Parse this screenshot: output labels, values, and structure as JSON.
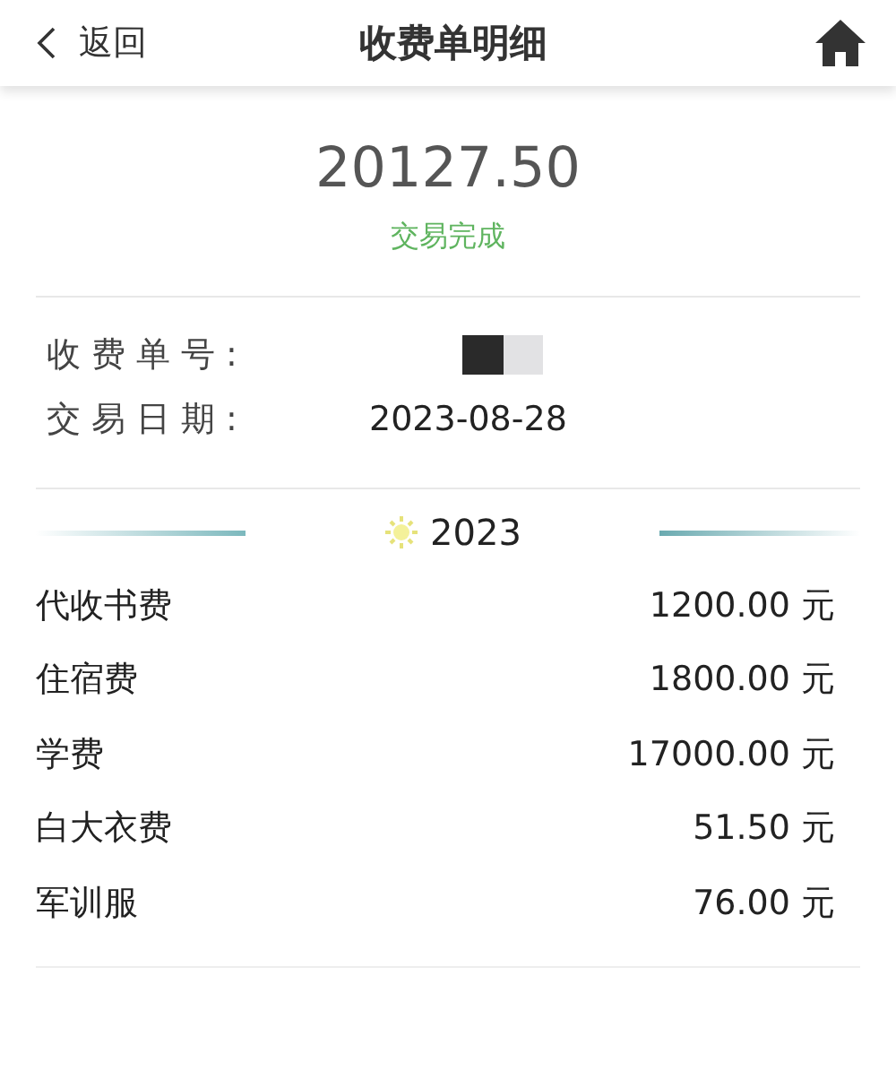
{
  "header": {
    "back": "返回",
    "title": "收费单明细"
  },
  "summary": {
    "amount": "20127.50",
    "status": "交易完成"
  },
  "info": [
    {
      "label": "收费单号:",
      "kind": "redacted"
    },
    {
      "label": "交易日期:",
      "kind": "text",
      "value": "2023-08-28"
    }
  ],
  "year": "2023",
  "items": [
    {
      "name": "代收书费",
      "amount": "1200.00 元"
    },
    {
      "name": "住宿费",
      "amount": "1800.00 元"
    },
    {
      "name": "学费",
      "amount": "17000.00 元"
    },
    {
      "name": "白大衣费",
      "amount": "51.50 元"
    },
    {
      "name": "军训服",
      "amount": "76.00 元"
    }
  ]
}
